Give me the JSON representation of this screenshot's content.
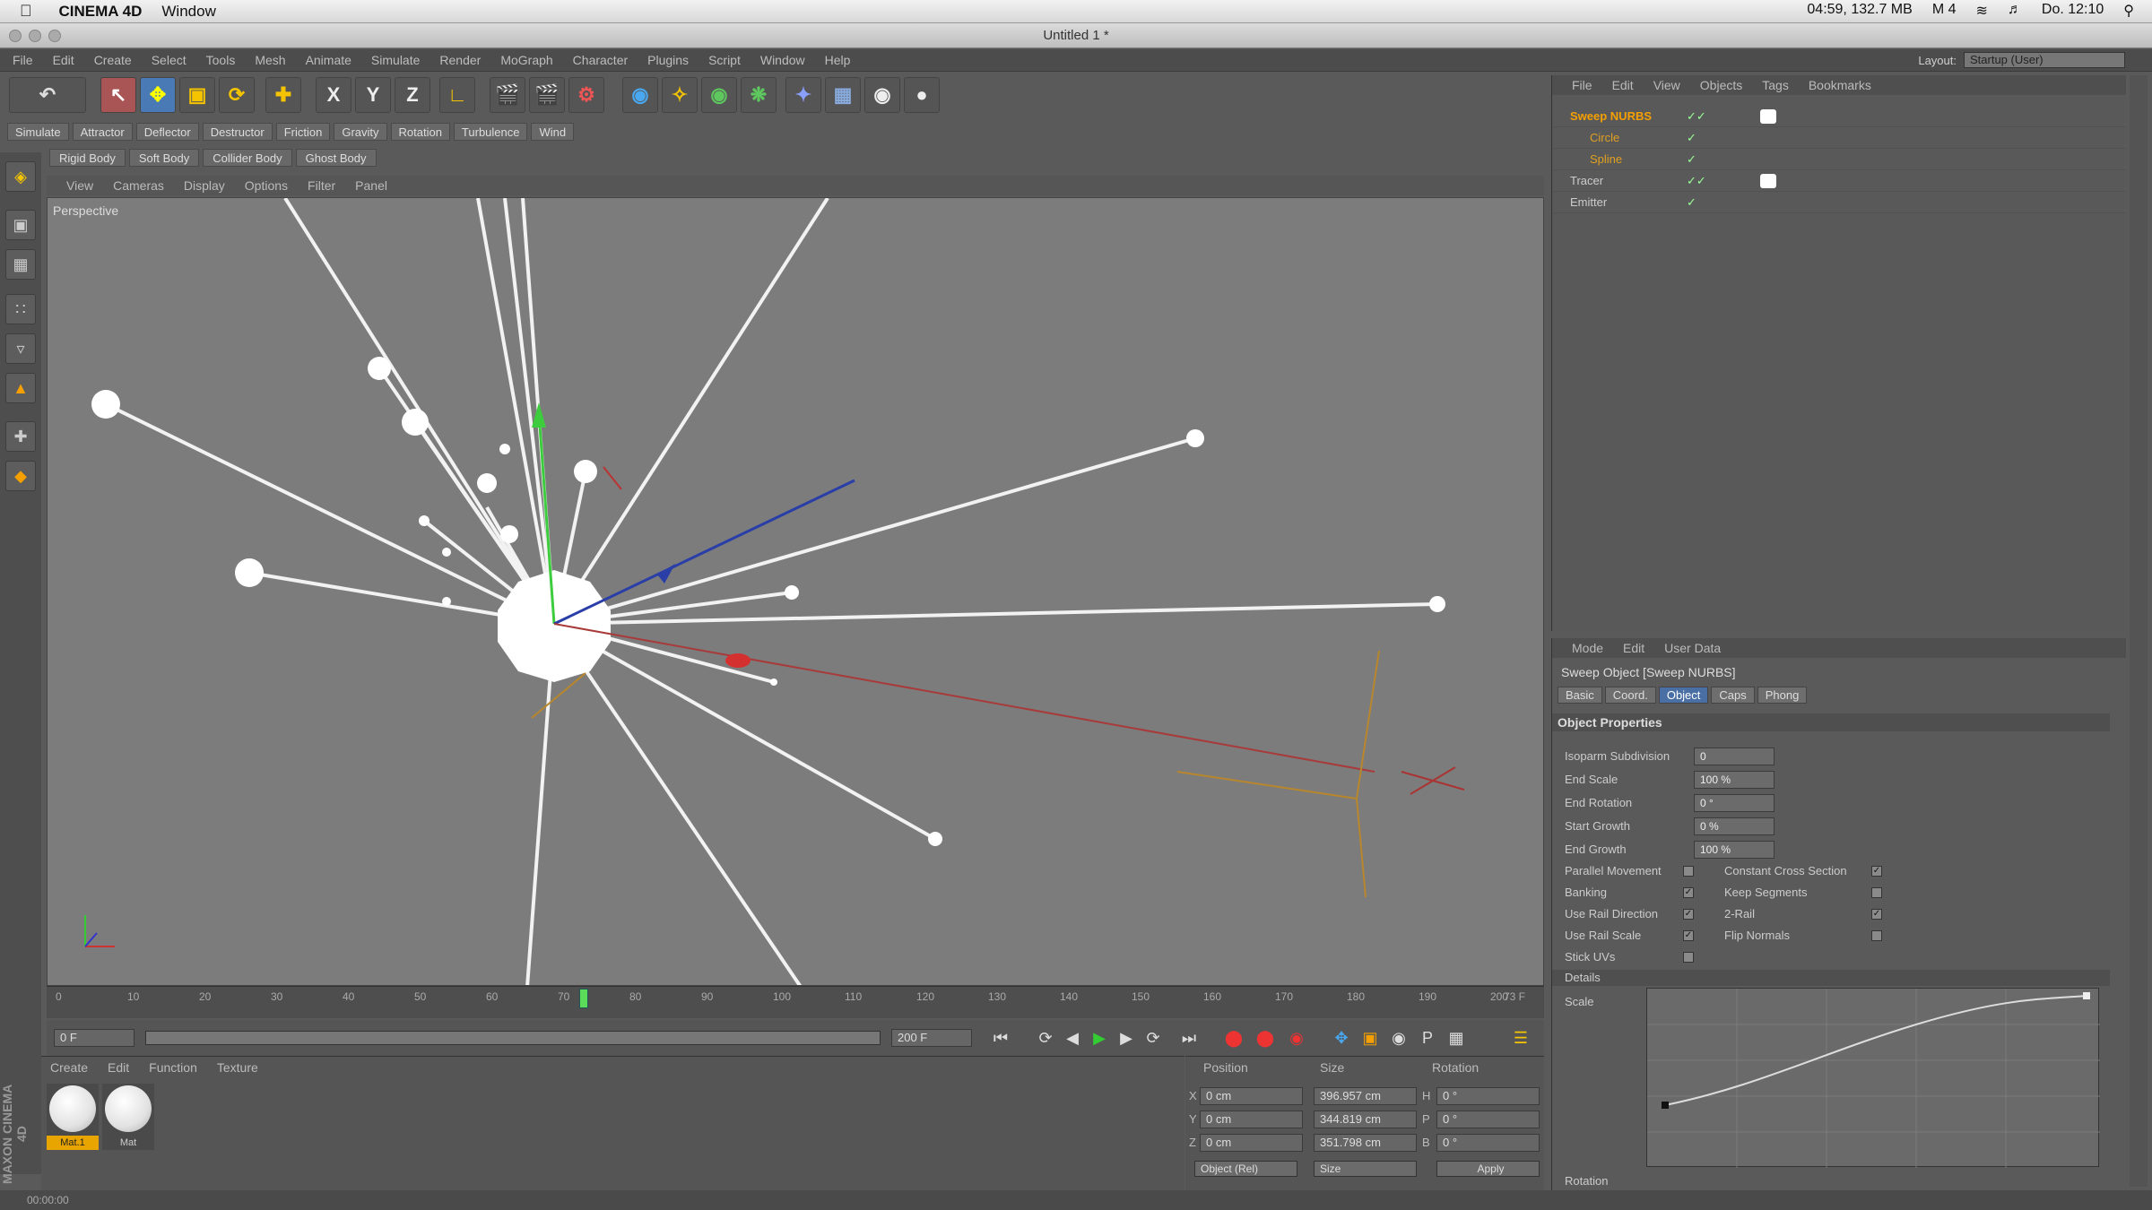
{
  "mac_menubar": {
    "app_name": "CINEMA 4D",
    "window_menu": "Window",
    "status_items": [
      "04:59, 132.7 MB",
      "M 4",
      "Do. 12:10"
    ]
  },
  "window_title": "Untitled 1 *",
  "c4d_menu": [
    "File",
    "Edit",
    "Create",
    "Select",
    "Tools",
    "Mesh",
    "Animate",
    "Simulate",
    "Render",
    "MoGraph",
    "Character",
    "Plugins",
    "Script",
    "Window",
    "Help"
  ],
  "layout": {
    "label": "Layout:",
    "value": "Startup (User)"
  },
  "toolbar": {
    "axis_x": "X",
    "axis_y": "Y",
    "axis_z": "Z"
  },
  "sub_toolbar": [
    "Simulate",
    "Attractor",
    "Deflector",
    "Destructor",
    "Friction",
    "Gravity",
    "Rotation",
    "Turbulence",
    "Wind"
  ],
  "dynamics_toolbar": [
    "Rigid Body",
    "Soft Body",
    "Collider Body",
    "Ghost Body"
  ],
  "viewport": {
    "menu": [
      "View",
      "Cameras",
      "Display",
      "Options",
      "Filter",
      "Panel"
    ],
    "label": "Perspective"
  },
  "timeline": {
    "ticks": [
      "0",
      "10",
      "20",
      "30",
      "40",
      "50",
      "60",
      "70",
      "80",
      "90",
      "100",
      "110",
      "120",
      "130",
      "140",
      "150",
      "160",
      "170",
      "180",
      "190",
      "200"
    ],
    "end_label": "73 F",
    "start_field": "0 F",
    "end_field": "200 F",
    "playhead_frame": 73
  },
  "material_manager": {
    "menu": [
      "Create",
      "Edit",
      "Function",
      "Texture"
    ],
    "materials": [
      "Mat.1",
      "Mat"
    ]
  },
  "coordinates": {
    "headers": [
      "Position",
      "Size",
      "Rotation"
    ],
    "rows": [
      {
        "axis": "X",
        "pos": "0 cm",
        "size": "396.957 cm",
        "rot_label": "H",
        "rot": "0 °"
      },
      {
        "axis": "Y",
        "pos": "0 cm",
        "size": "344.819 cm",
        "rot_label": "P",
        "rot": "0 °"
      },
      {
        "axis": "Z",
        "pos": "0 cm",
        "size": "351.798 cm",
        "rot_label": "B",
        "rot": "0 °"
      }
    ],
    "mode_dropdown": "Object (Rel)",
    "size_dropdown": "Size",
    "apply_button": "Apply"
  },
  "status_bar": "00:00:00",
  "maxon_logo": "MAXON CINEMA 4D",
  "object_manager": {
    "menu": [
      "File",
      "Edit",
      "View",
      "Objects",
      "Tags",
      "Bookmarks"
    ],
    "objects": [
      {
        "name": "Sweep NURBS",
        "selected": true,
        "indent": 0,
        "tag": true
      },
      {
        "name": "Circle",
        "selected": false,
        "indent": 1,
        "tag": false
      },
      {
        "name": "Spline",
        "selected": false,
        "indent": 1,
        "tag": false
      },
      {
        "name": "Tracer",
        "selected": false,
        "indent": 0,
        "tag": true
      },
      {
        "name": "Emitter",
        "selected": false,
        "indent": 0,
        "tag": false
      }
    ]
  },
  "attribute_manager": {
    "menu": [
      "Mode",
      "Edit",
      "User Data"
    ],
    "title": "Sweep Object [Sweep NURBS]",
    "tabs": [
      "Basic",
      "Coord.",
      "Object",
      "Caps",
      "Phong"
    ],
    "active_tab": "Object",
    "section": "Object Properties",
    "properties": [
      {
        "label": "Isoparm Subdivision",
        "value": "0"
      },
      {
        "label": "End Scale",
        "value": "100 %"
      },
      {
        "label": "End Rotation",
        "value": "0 °"
      },
      {
        "label": "Start Growth",
        "value": "0 %"
      },
      {
        "label": "End Growth",
        "value": "100 %"
      }
    ],
    "checkboxes_left": [
      {
        "label": "Parallel Movement",
        "checked": false
      },
      {
        "label": "Banking",
        "checked": true
      },
      {
        "label": "Use Rail Direction",
        "checked": true
      },
      {
        "label": "Use Rail Scale",
        "checked": true
      },
      {
        "label": "Stick UVs",
        "checked": false
      }
    ],
    "checkboxes_right": [
      {
        "label": "Constant Cross Section",
        "checked": true
      },
      {
        "label": "Keep Segments",
        "checked": false
      },
      {
        "label": "2-Rail",
        "checked": true
      },
      {
        "label": "Flip Normals",
        "checked": false
      }
    ],
    "details_section": "Details",
    "scale_label": "Scale",
    "rotation_label": "Rotation"
  }
}
